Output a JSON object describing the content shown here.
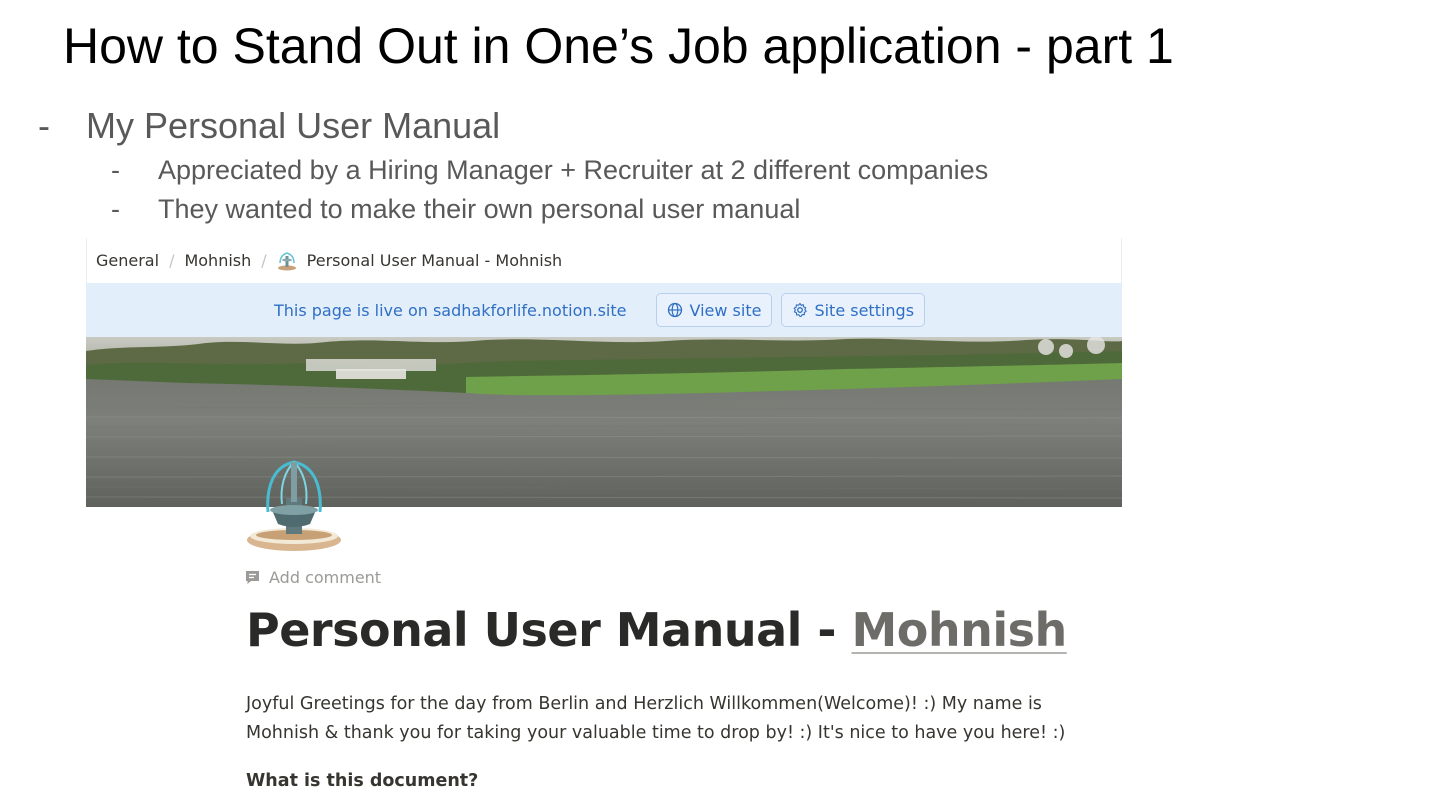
{
  "slide": {
    "title": "How to Stand Out in One’s Job application - part 1",
    "bullets": {
      "dash": "-",
      "main": "My Personal User Manual",
      "sub": [
        "Appreciated by a Hiring Manager + Recruiter at 2 different companies",
        "They wanted to make their own personal user manual"
      ]
    }
  },
  "notion": {
    "breadcrumb": {
      "items": [
        "General",
        "Mohnish",
        "Personal User Manual - Mohnish"
      ],
      "separator": "/"
    },
    "banner": {
      "text": "This page is live on sadhakforlife.notion.site",
      "view_site": "View site",
      "site_settings": "Site settings",
      "accent": "#2f6fc4",
      "background": "#e3eefb"
    },
    "cover": {
      "description_icon": "river-landscape"
    },
    "page_icon": "fountain-icon",
    "add_comment": "Add comment",
    "title_prefix": "Personal User Manual - ",
    "title_name": "Mohnish",
    "intro": "Joyful Greetings for the day from Berlin and Herzlich Willkommen(Welcome)! :) My name is Mohnish & thank you for taking your valuable time to drop by! :) It's nice to have you here! :)",
    "section_heading": "What is this document?"
  }
}
